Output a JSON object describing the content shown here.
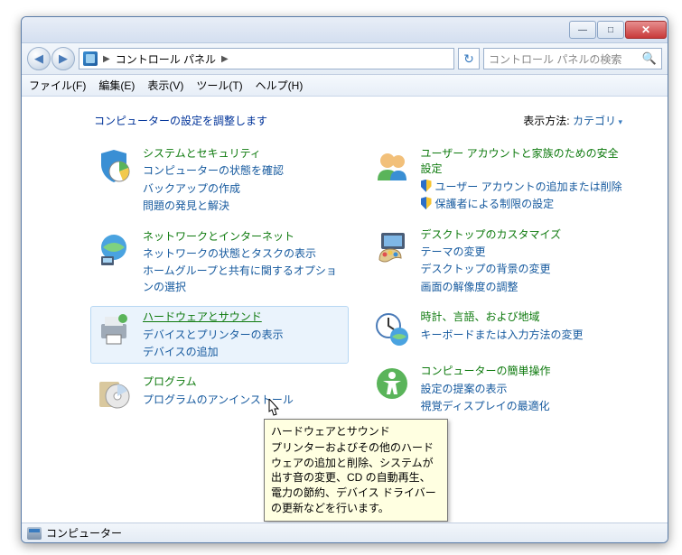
{
  "titlebar": {
    "min": "—",
    "max": "□",
    "close": "✕"
  },
  "address": {
    "root": "コントロール パネル",
    "sep": "▶"
  },
  "search": {
    "placeholder": "コントロール パネルの検索"
  },
  "menu": {
    "file": "ファイル(F)",
    "edit": "編集(E)",
    "view": "表示(V)",
    "tools": "ツール(T)",
    "help": "ヘルプ(H)"
  },
  "header": {
    "title": "コンピューターの設定を調整します",
    "view_label": "表示方法:",
    "view_value": "カテゴリ"
  },
  "left": [
    {
      "title": "システムとセキュリティ",
      "links": [
        "コンピューターの状態を確認",
        "バックアップの作成",
        "問題の発見と解決"
      ]
    },
    {
      "title": "ネットワークとインターネット",
      "links": [
        "ネットワークの状態とタスクの表示",
        "ホームグループと共有に関するオプションの選択"
      ]
    },
    {
      "title": "ハードウェアとサウンド",
      "links": [
        "デバイスとプリンターの表示",
        "デバイスの追加"
      ]
    },
    {
      "title": "プログラム",
      "links": [
        "プログラムのアンインストール"
      ]
    }
  ],
  "right": [
    {
      "title": "ユーザー アカウントと家族のための安全設定",
      "links": [
        {
          "t": "ユーザー アカウントの追加または削除",
          "shield": true
        },
        {
          "t": "保護者による制限の設定",
          "shield": true
        }
      ]
    },
    {
      "title": "デスクトップのカスタマイズ",
      "links": [
        "テーマの変更",
        "デスクトップの背景の変更",
        "画面の解像度の調整"
      ]
    },
    {
      "title": "時計、言語、および地域",
      "links": [
        "キーボードまたは入力方法の変更"
      ]
    },
    {
      "title": "コンピューターの簡単操作",
      "links": [
        "設定の提案の表示",
        "視覚ディスプレイの最適化"
      ]
    }
  ],
  "tooltip": {
    "title": "ハードウェアとサウンド",
    "body": "プリンターおよびその他のハードウェアの追加と削除、システムが出す音の変更、CD の自動再生、電力の節約、デバイス ドライバーの更新などを行います。"
  },
  "status": {
    "text": "コンピューター"
  }
}
